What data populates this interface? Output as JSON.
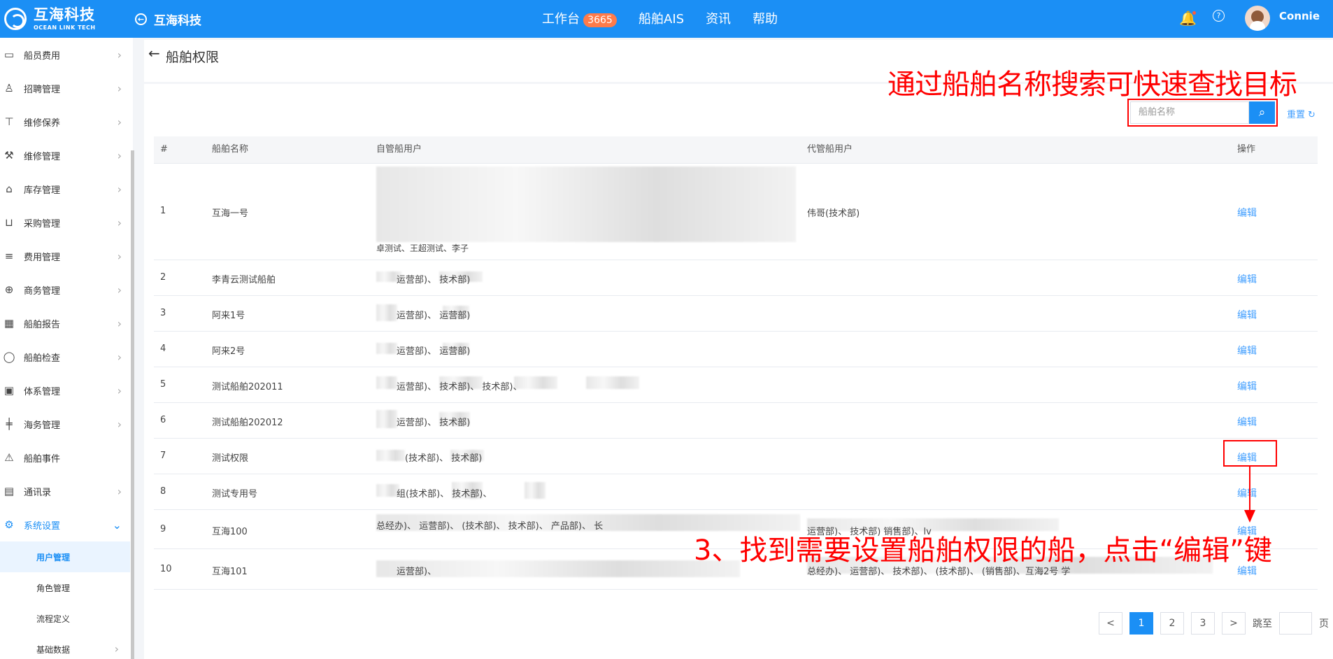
{
  "topbar": {
    "logo_cn": "互海科技",
    "logo_en": "OCEAN LINK TECH",
    "company": "互海科技",
    "nav": [
      {
        "label": "工作台",
        "badge": "3665"
      },
      {
        "label": "船舶AIS"
      },
      {
        "label": "资讯"
      },
      {
        "label": "帮助"
      }
    ],
    "username": "Connie"
  },
  "sidebar": {
    "items": [
      {
        "label": "船员费用",
        "icon": "wallet-icon"
      },
      {
        "label": "招聘管理",
        "icon": "user-icon"
      },
      {
        "label": "维修保养",
        "icon": "tool-icon"
      },
      {
        "label": "维修管理",
        "icon": "wrench-icon"
      },
      {
        "label": "库存管理",
        "icon": "warehouse-icon"
      },
      {
        "label": "采购管理",
        "icon": "cart-icon"
      },
      {
        "label": "费用管理",
        "icon": "database-icon"
      },
      {
        "label": "商务管理",
        "icon": "globe-icon"
      },
      {
        "label": "船舶报告",
        "icon": "calendar-icon"
      },
      {
        "label": "船舶检查",
        "icon": "check-circle-icon"
      },
      {
        "label": "体系管理",
        "icon": "copy-icon"
      },
      {
        "label": "海务管理",
        "icon": "signpost-icon"
      },
      {
        "label": "船舶事件",
        "icon": "warning-icon"
      },
      {
        "label": "通讯录",
        "icon": "contacts-icon"
      },
      {
        "label": "系统设置",
        "icon": "gear-icon"
      }
    ],
    "subitems": [
      "用户管理",
      "角色管理",
      "流程定义",
      "基础数据"
    ]
  },
  "page": {
    "title": "船舶权限"
  },
  "search": {
    "placeholder": "船舶名称",
    "reset": "重置"
  },
  "annotations": {
    "top": "通过船舶名称搜索可快速查找目标",
    "bottom": "3、找到需要设置船舶权限的船，点击“编辑”键"
  },
  "table": {
    "headers": [
      "#",
      "船舶名称",
      "自管船用户",
      "代管船用户",
      "操作"
    ],
    "rows": [
      {
        "num": "1",
        "name": "互海一号",
        "self": "卓测试、王超测试、李子",
        "agent": "伟哥(技术部)",
        "action": "编辑"
      },
      {
        "num": "2",
        "name": "李青云测试船舶",
        "self": "运营部)、 技术部)",
        "agent": "",
        "action": "编辑"
      },
      {
        "num": "3",
        "name": "阿来1号",
        "self": "运营部)、 运营部)",
        "agent": "",
        "action": "编辑"
      },
      {
        "num": "4",
        "name": "阿来2号",
        "self": "运营部)、 运营部)",
        "agent": "",
        "action": "编辑"
      },
      {
        "num": "5",
        "name": "测试船舶202011",
        "self": "运营部)、 技术部)、 技术部)、",
        "agent": "",
        "action": "编辑"
      },
      {
        "num": "6",
        "name": "测试船舶202012",
        "self": "运营部)、 技术部)",
        "agent": "",
        "action": "编辑"
      },
      {
        "num": "7",
        "name": "测试权限",
        "self": "(技术部)、 技术部)",
        "agent": "",
        "action": "编辑"
      },
      {
        "num": "8",
        "name": "测试专用号",
        "self": "组(技术部)、 技术部)、",
        "agent": "",
        "action": "编辑"
      },
      {
        "num": "9",
        "name": "互海100",
        "self": "总经办)、 运营部)、 (技术部)、 技术部)、 产品部)、 长",
        "agent": "运营部)、 技术部) 销售部)、lv",
        "action": "编辑"
      },
      {
        "num": "10",
        "name": "互海101",
        "self": "运营部)、",
        "agent": "总经办)、 运营部)、 技术部)、 (技术部)、 (销售部)、互海2号 学",
        "action": "编辑"
      }
    ]
  },
  "pagination": {
    "prev": "<",
    "pages": [
      "1",
      "2",
      "3"
    ],
    "next": ">",
    "jump_label": "跳至",
    "page_unit": "页",
    "current": 1
  },
  "colors": {
    "brand_blue": "#1b8ff5",
    "annotation_red": "#ff0000",
    "badge_orange": "#ff7b4a"
  }
}
